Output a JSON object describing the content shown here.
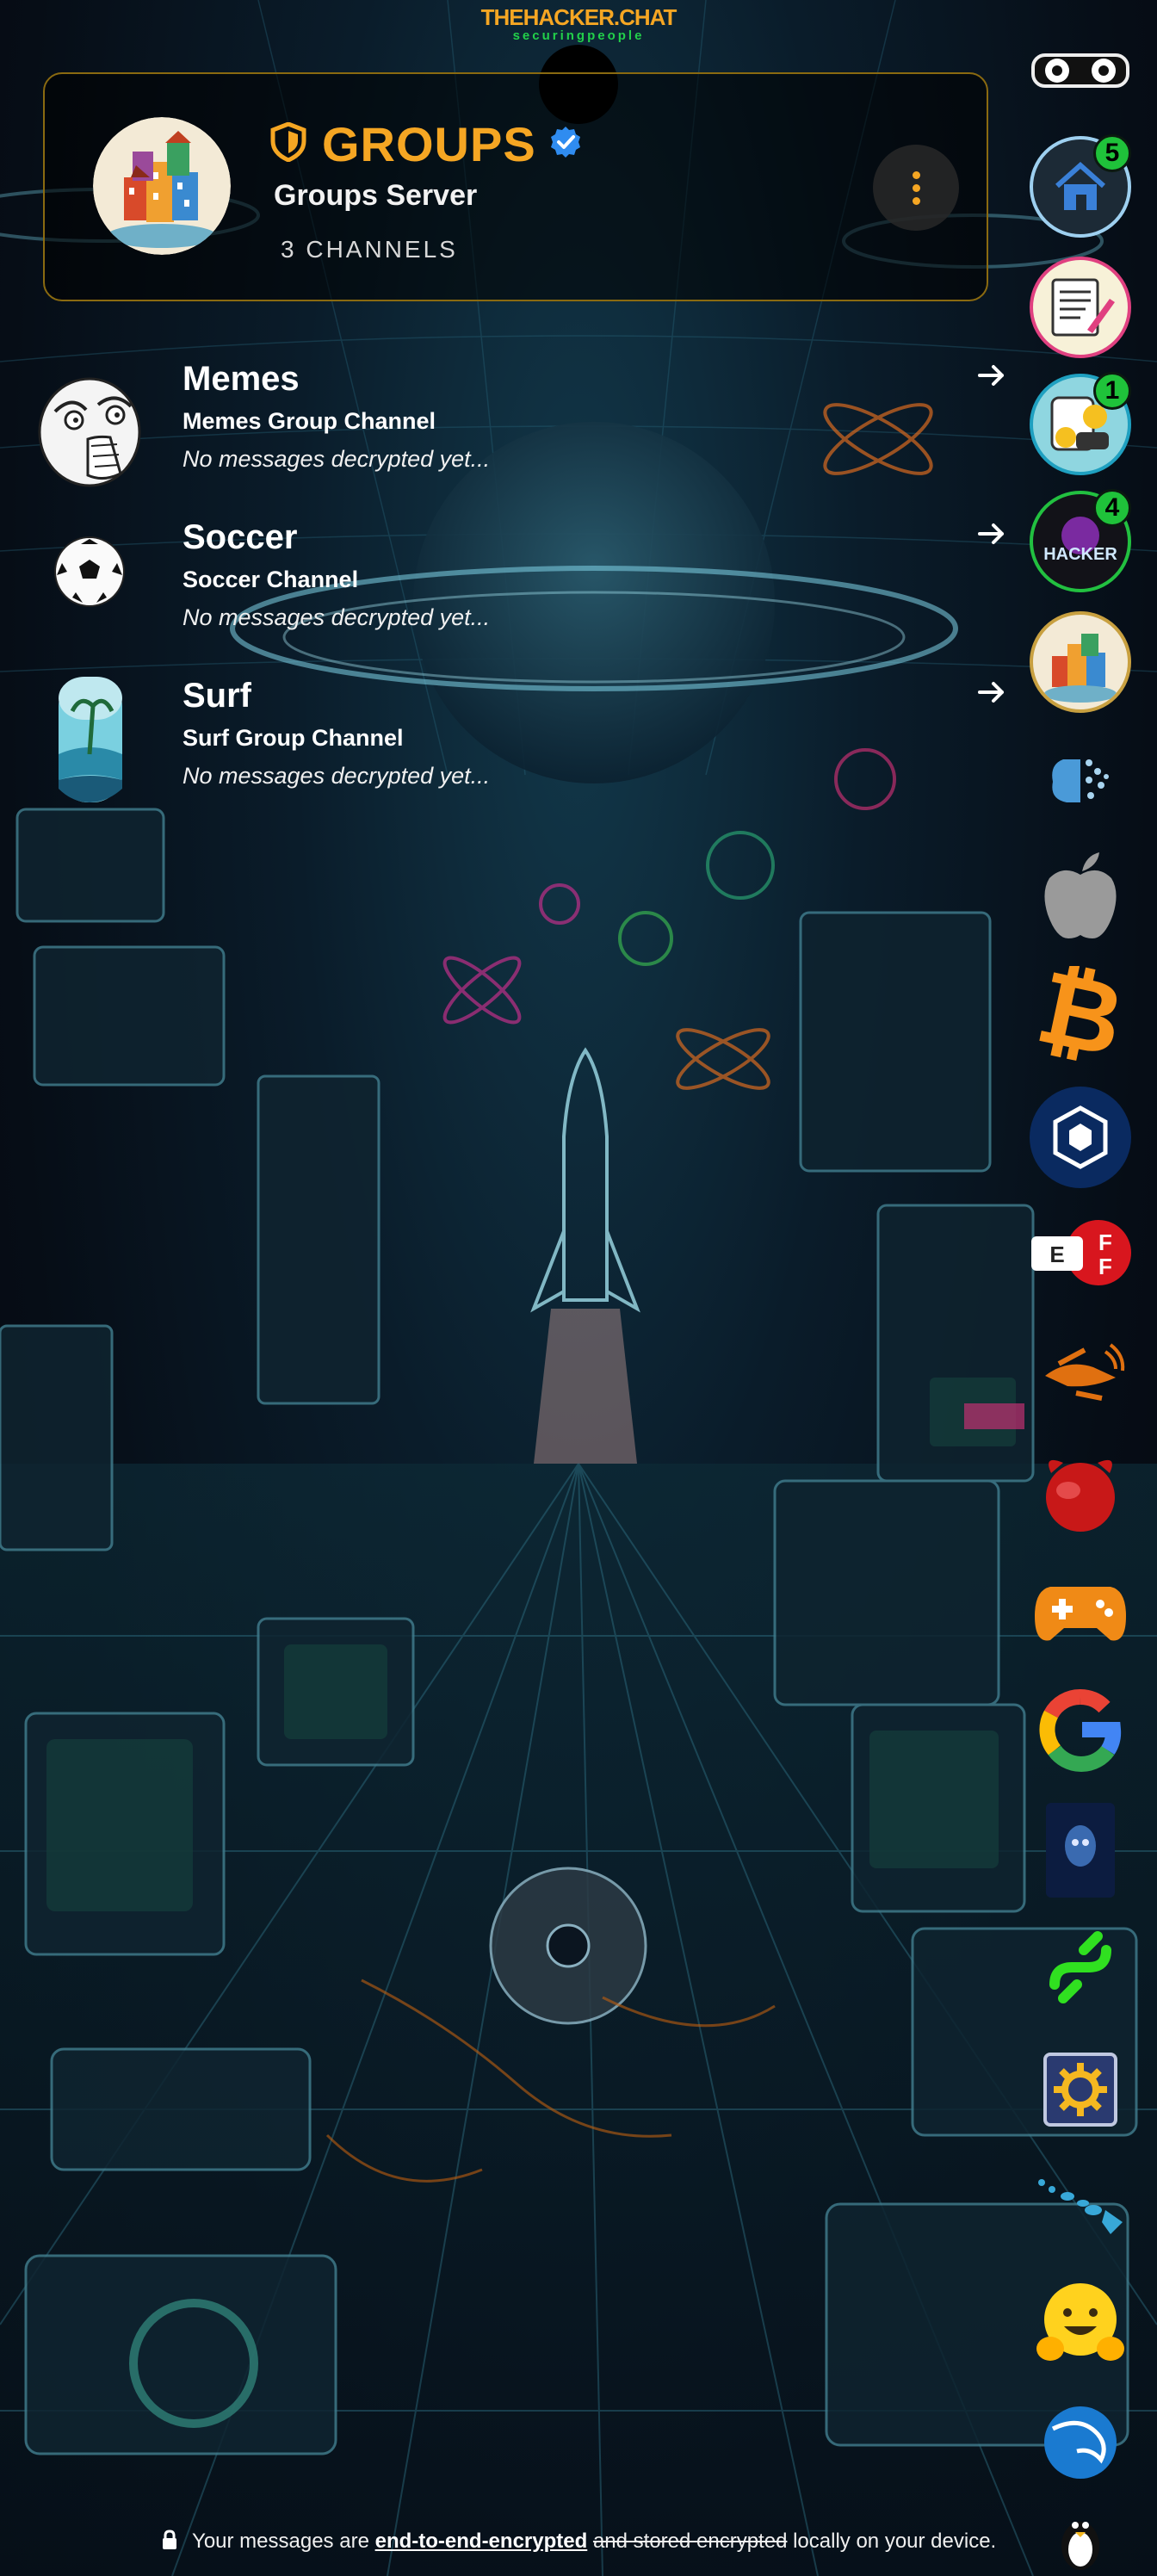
{
  "brand": {
    "title": "THEHACKER.CHAT",
    "subtitle": "securingpeople"
  },
  "server": {
    "title": "GROUPS",
    "name": "Groups Server",
    "channel_count": "3 CHANNELS",
    "verified": true,
    "accent_color": "#f5a623"
  },
  "channels": [
    {
      "name": "Memes",
      "description": "Memes Group Channel",
      "last_message": "No messages decrypted yet...",
      "icon": "troll-face-avatar"
    },
    {
      "name": "Soccer",
      "description": "Soccer Channel",
      "last_message": "No messages decrypted yet...",
      "icon": "soccer-ball-avatar"
    },
    {
      "name": "Surf",
      "description": "Surf Group Channel",
      "last_message": "No messages decrypted yet...",
      "icon": "surf-board-avatar"
    }
  ],
  "rail": [
    {
      "name": "glasses-icon"
    },
    {
      "name": "home-icon",
      "badge": "5"
    },
    {
      "name": "notes-icon"
    },
    {
      "name": "chat-bot-icon",
      "badge": "1"
    },
    {
      "name": "hacker-icon",
      "badge": "4"
    },
    {
      "name": "groups-icon"
    },
    {
      "name": "brain-icon"
    },
    {
      "name": "apple-icon"
    },
    {
      "name": "bitcoin-icon"
    },
    {
      "name": "crypto-icon"
    },
    {
      "name": "eff-icon"
    },
    {
      "name": "drone-icon"
    },
    {
      "name": "freebsd-icon"
    },
    {
      "name": "gamepad-icon"
    },
    {
      "name": "google-icon"
    },
    {
      "name": "movie-icon"
    },
    {
      "name": "chain-icon"
    },
    {
      "name": "settings-icon"
    },
    {
      "name": "hawaii-icon"
    },
    {
      "name": "hugging-face-icon"
    },
    {
      "name": "kali-icon"
    },
    {
      "name": "linux-icon"
    }
  ],
  "footer": {
    "prefix": "Your messages are",
    "link": "end-to-end-encrypted",
    "strike": "and stored encrypted",
    "suffix": "locally on your device."
  }
}
